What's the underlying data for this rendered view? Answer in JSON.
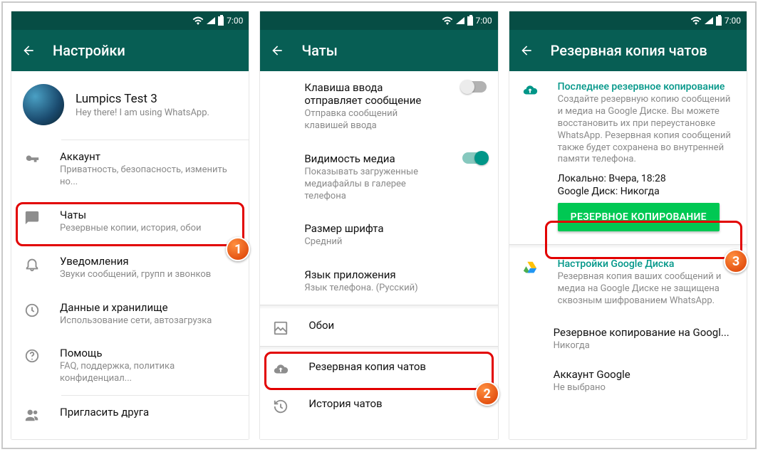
{
  "status": {
    "time": "7:00"
  },
  "screen1": {
    "title": "Настройки",
    "profile": {
      "name": "Lumpics Test 3",
      "status": "Hey there! I am using WhatsApp."
    },
    "items": [
      {
        "title": "Аккаунт",
        "sub": "Приватность, безопасность, изменить но..."
      },
      {
        "title": "Чаты",
        "sub": "Резервные копии, история, обои"
      },
      {
        "title": "Уведомления",
        "sub": "Звуки сообщений, групп и звонков"
      },
      {
        "title": "Данные и хранилище",
        "sub": "Использование сети, автозагрузка"
      },
      {
        "title": "Помощь",
        "sub": "FAQ, поддержка, политика конфиденциал..."
      },
      {
        "title": "Пригласить друга",
        "sub": ""
      }
    ]
  },
  "screen2": {
    "title": "Чаты",
    "items": [
      {
        "title": "Клавиша ввода отправляет сообщение",
        "sub": "Отправка сообщений клавишей ввода"
      },
      {
        "title": "Видимость медиа",
        "sub": "Показывать загруженные медиафайлы в галерее телефона"
      },
      {
        "title": "Размер шрифта",
        "sub": "Средний"
      },
      {
        "title": "Язык приложения",
        "sub": "Язык телефона. (Русский)"
      }
    ],
    "wallpaper": "Обои",
    "backup": "Резервная копия чатов",
    "history": "История чатов"
  },
  "screen3": {
    "title": "Резервная копия чатов",
    "last_backup": {
      "heading": "Последнее резервное копирование",
      "desc": "Создайте резервную копию сообщений и медиа на Google Диске. Вы можете восстановить их при переустановке WhatsApp. Резервная копия сообщений также будет сохранена во внутренней памяти телефона.",
      "local_label": "Локально:",
      "local_value": "Вчера, 18:28",
      "drive_label": "Google Диск:",
      "drive_value": "Никогда"
    },
    "button": "РЕЗЕРВНОЕ КОПИРОВАНИЕ",
    "gdrive": {
      "heading": "Настройки Google Диска",
      "desc": "Резервная копия ваших сообщений и медиа на Google Диске не защищена сквозным шифрованием WhatsApp."
    },
    "rows": [
      {
        "title": "Резервное копирование на Googl...",
        "sub": "Никогда"
      },
      {
        "title": "Аккаунт Google",
        "sub": "Не выбрано"
      }
    ]
  },
  "steps": {
    "s1": "1",
    "s2": "2",
    "s3": "3"
  }
}
